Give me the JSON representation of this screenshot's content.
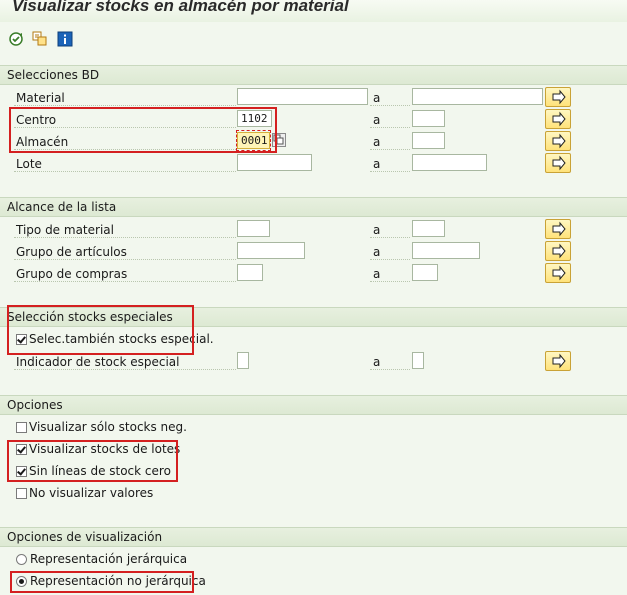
{
  "window": {
    "title": "Visualizar stocks en almacén por material"
  },
  "toolbar": {
    "icons": [
      "execute-icon",
      "get-variant-icon",
      "info-icon"
    ]
  },
  "sections": {
    "db": "Selecciones BD",
    "scope": "Alcance de la lista",
    "special": "Selección stocks especiales",
    "options": "Opciones",
    "display": "Opciones de visualización"
  },
  "fields": {
    "material": {
      "label": "Material",
      "from": "",
      "to": ""
    },
    "centro": {
      "label": "Centro",
      "from": "1102",
      "to": ""
    },
    "almacen": {
      "label": "Almacén",
      "from": "0001",
      "to": ""
    },
    "lote": {
      "label": "Lote",
      "from": "",
      "to": ""
    },
    "tipo_material": {
      "label": "Tipo de material",
      "from": "",
      "to": ""
    },
    "grupo_articulos": {
      "label": "Grupo de artículos",
      "from": "",
      "to": ""
    },
    "grupo_compras": {
      "label": "Grupo de compras",
      "from": "",
      "to": ""
    },
    "indicador_stock": {
      "label": "Indicador de stock especial",
      "from": "",
      "to": ""
    }
  },
  "range_sep": "a",
  "checkboxes": {
    "special_stocks": {
      "label": "Selec.también stocks especial.",
      "checked": true
    },
    "neg_only": {
      "label": "Visualizar sólo stocks neg.",
      "checked": false
    },
    "batch_stocks": {
      "label": "Visualizar stocks de lotes",
      "checked": true
    },
    "no_zero_lines": {
      "label": "Sin líneas de stock cero",
      "checked": true
    },
    "no_values": {
      "label": "No visualizar valores",
      "checked": false
    }
  },
  "radios": {
    "hier": {
      "label": "Representación jerárquica",
      "selected": false
    },
    "non_hier": {
      "label": "Representación no jerárquica",
      "selected": true
    }
  },
  "colors": {
    "highlight": "#d42020",
    "section_bg": "#e4eedb"
  }
}
